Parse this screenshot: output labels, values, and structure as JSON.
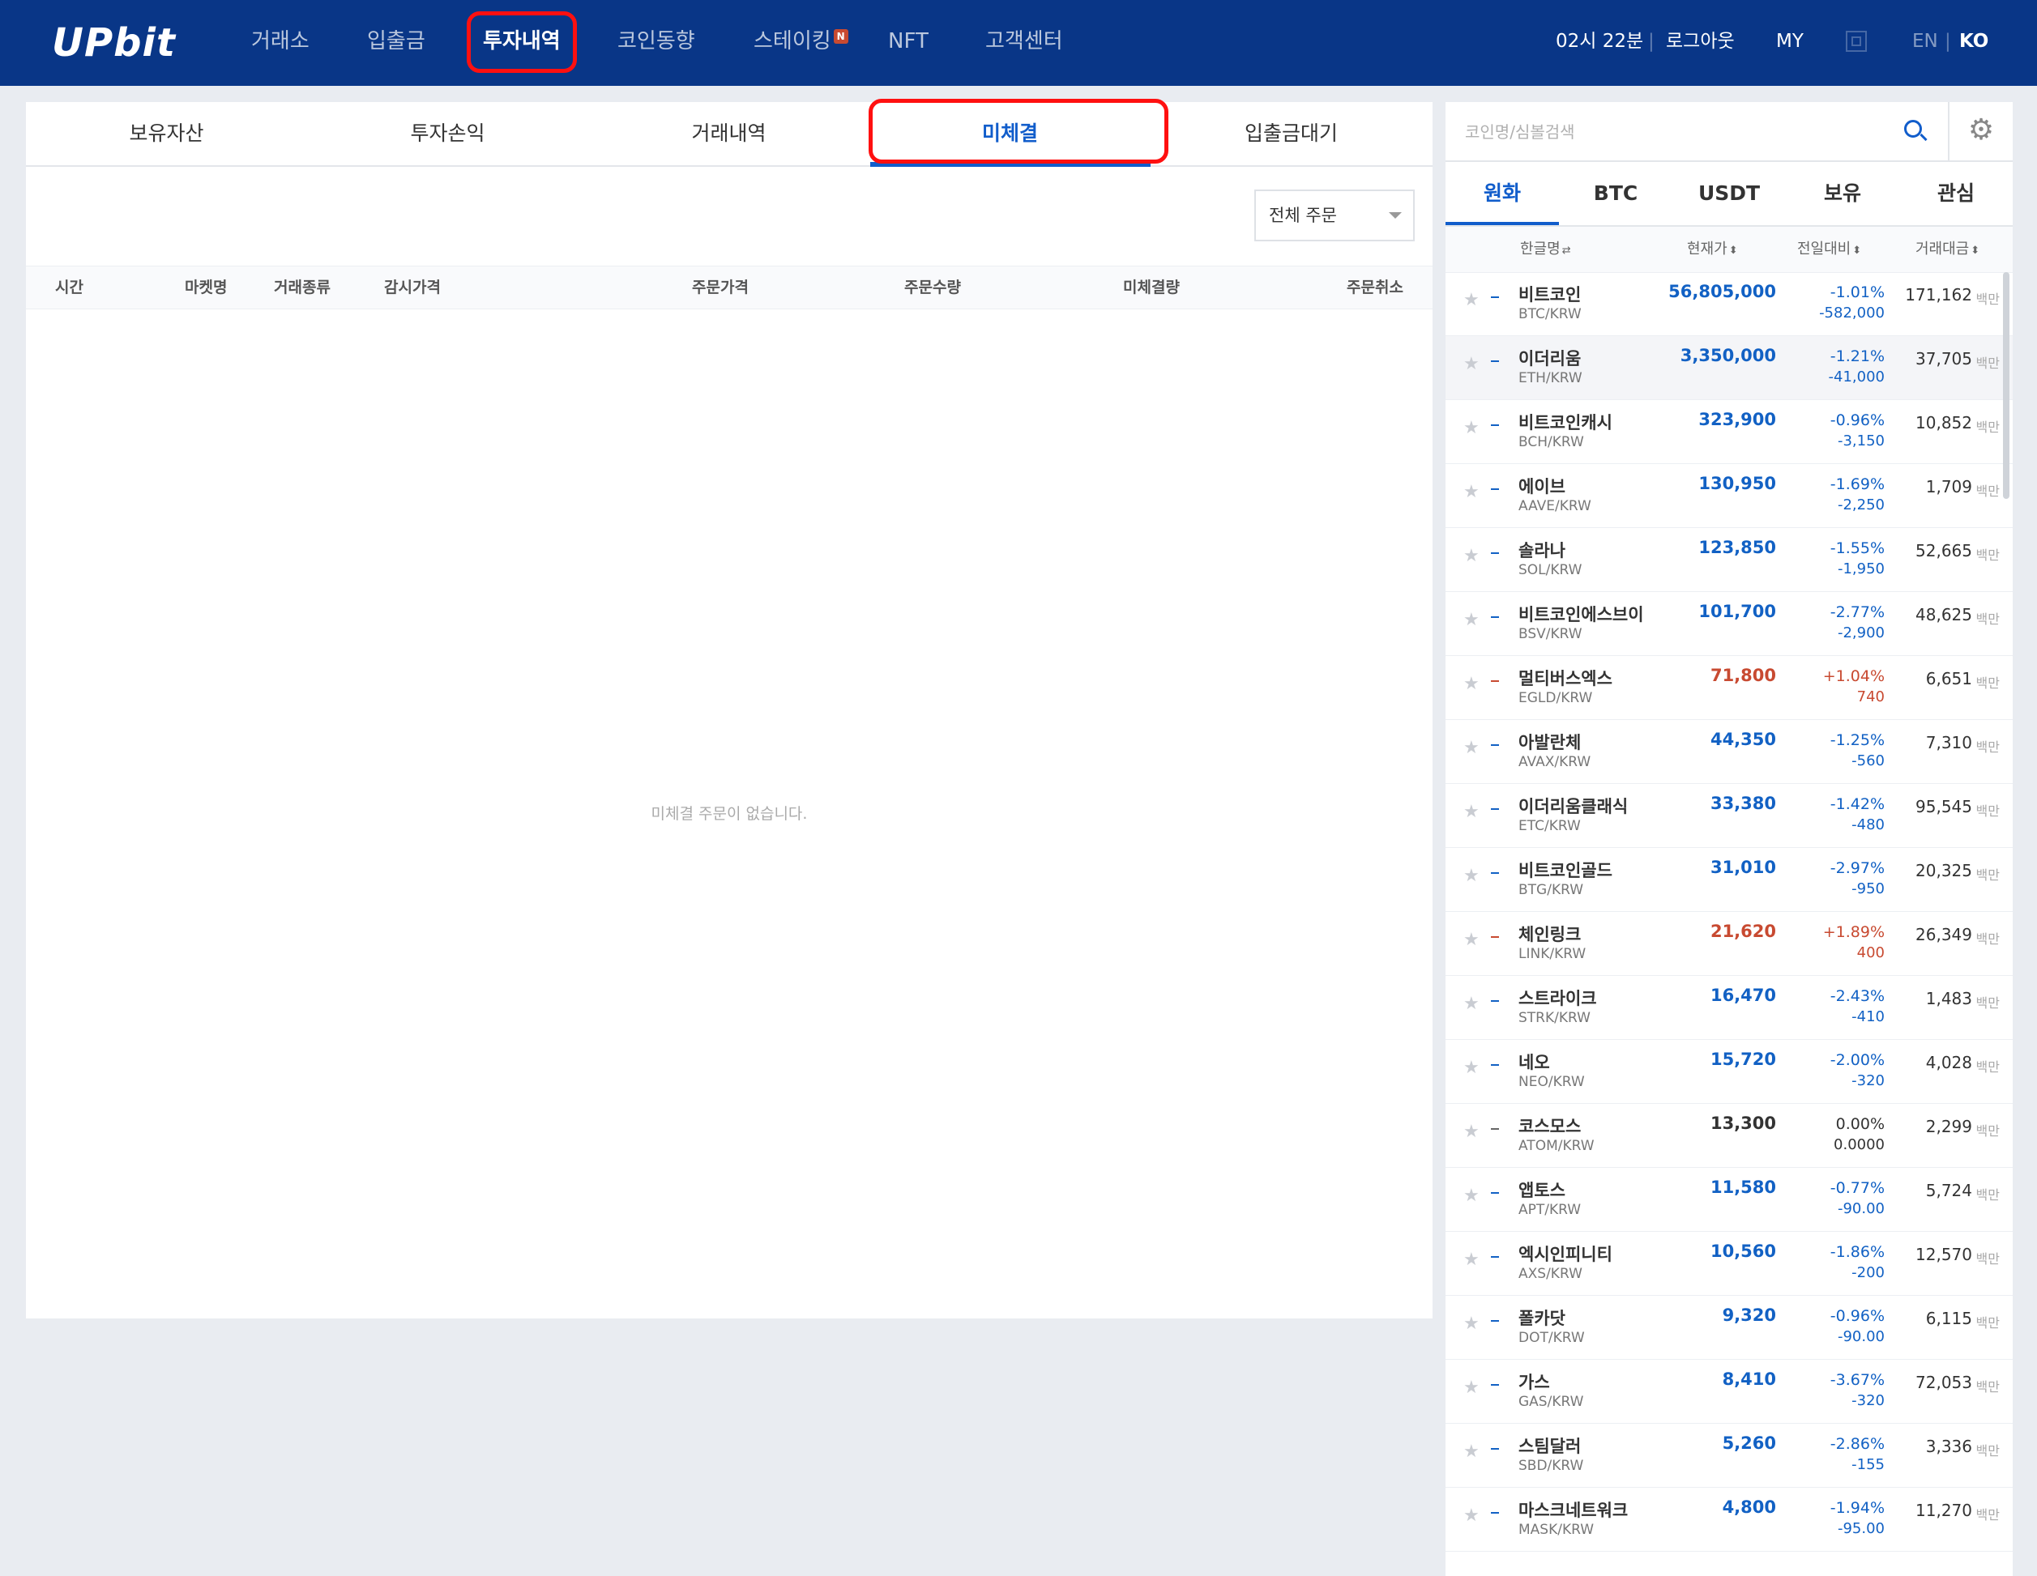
{
  "header": {
    "logo": "UPbit",
    "nav": [
      {
        "label": "거래소"
      },
      {
        "label": "입출금"
      },
      {
        "label": "투자내역"
      },
      {
        "label": "코인동향"
      },
      {
        "label": "스테이킹",
        "badge": "N"
      },
      {
        "label": "NFT"
      },
      {
        "label": "고객센터"
      }
    ],
    "time": "02시 22분",
    "separator": "|",
    "logout": "로그아웃",
    "my": "MY",
    "lang_en": "EN",
    "lang_ko": "KO"
  },
  "investment": {
    "tabs": [
      {
        "label": "보유자산"
      },
      {
        "label": "투자손익"
      },
      {
        "label": "거래내역"
      },
      {
        "label": "미체결"
      },
      {
        "label": "입출금대기"
      }
    ],
    "active_tab": "미체결",
    "filter_value": "전체 주문",
    "columns": {
      "time": "시간",
      "market": "마켓명",
      "trade_type": "거래종류",
      "watch_price": "감시가격",
      "order_price": "주문가격",
      "order_qty": "주문수량",
      "unfilled_qty": "미체결량",
      "cancel": "주문취소"
    },
    "empty_message": "미체결 주문이 없습니다."
  },
  "market": {
    "search_placeholder": "코인명/심볼검색",
    "tabs": [
      {
        "label": "원화"
      },
      {
        "label": "BTC"
      },
      {
        "label": "USDT"
      },
      {
        "label": "보유"
      },
      {
        "label": "관심"
      }
    ],
    "active_tab": "원화",
    "columns": {
      "name": "한글명",
      "price": "현재가",
      "change": "전일대비",
      "volume": "거래대금"
    },
    "volume_unit": "백만",
    "colors": {
      "down": "#1261c4",
      "up": "#c84a31",
      "even": "#333333"
    },
    "coins": [
      {
        "name": "비트코인",
        "pair": "BTC/KRW",
        "price": "56,805,000",
        "rate": "-1.01%",
        "diff": "-582,000",
        "volume": "171,162",
        "dir": "down"
      },
      {
        "name": "이더리움",
        "pair": "ETH/KRW",
        "price": "3,350,000",
        "rate": "-1.21%",
        "diff": "-41,000",
        "volume": "37,705",
        "dir": "down"
      },
      {
        "name": "비트코인캐시",
        "pair": "BCH/KRW",
        "price": "323,900",
        "rate": "-0.96%",
        "diff": "-3,150",
        "volume": "10,852",
        "dir": "down"
      },
      {
        "name": "에이브",
        "pair": "AAVE/KRW",
        "price": "130,950",
        "rate": "-1.69%",
        "diff": "-2,250",
        "volume": "1,709",
        "dir": "down"
      },
      {
        "name": "솔라나",
        "pair": "SOL/KRW",
        "price": "123,850",
        "rate": "-1.55%",
        "diff": "-1,950",
        "volume": "52,665",
        "dir": "down"
      },
      {
        "name": "비트코인에스브이",
        "pair": "BSV/KRW",
        "price": "101,700",
        "rate": "-2.77%",
        "diff": "-2,900",
        "volume": "48,625",
        "dir": "down"
      },
      {
        "name": "멀티버스엑스",
        "pair": "EGLD/KRW",
        "price": "71,800",
        "rate": "+1.04%",
        "diff": "740",
        "volume": "6,651",
        "dir": "up"
      },
      {
        "name": "아발란체",
        "pair": "AVAX/KRW",
        "price": "44,350",
        "rate": "-1.25%",
        "diff": "-560",
        "volume": "7,310",
        "dir": "down"
      },
      {
        "name": "이더리움클래식",
        "pair": "ETC/KRW",
        "price": "33,380",
        "rate": "-1.42%",
        "diff": "-480",
        "volume": "95,545",
        "dir": "down"
      },
      {
        "name": "비트코인골드",
        "pair": "BTG/KRW",
        "price": "31,010",
        "rate": "-2.97%",
        "diff": "-950",
        "volume": "20,325",
        "dir": "down"
      },
      {
        "name": "체인링크",
        "pair": "LINK/KRW",
        "price": "21,620",
        "rate": "+1.89%",
        "diff": "400",
        "volume": "26,349",
        "dir": "up"
      },
      {
        "name": "스트라이크",
        "pair": "STRK/KRW",
        "price": "16,470",
        "rate": "-2.43%",
        "diff": "-410",
        "volume": "1,483",
        "dir": "down"
      },
      {
        "name": "네오",
        "pair": "NEO/KRW",
        "price": "15,720",
        "rate": "-2.00%",
        "diff": "-320",
        "volume": "4,028",
        "dir": "down"
      },
      {
        "name": "코스모스",
        "pair": "ATOM/KRW",
        "price": "13,300",
        "rate": "0.00%",
        "diff": "0.0000",
        "volume": "2,299",
        "dir": "even"
      },
      {
        "name": "앱토스",
        "pair": "APT/KRW",
        "price": "11,580",
        "rate": "-0.77%",
        "diff": "-90.00",
        "volume": "5,724",
        "dir": "down"
      },
      {
        "name": "엑시인피니티",
        "pair": "AXS/KRW",
        "price": "10,560",
        "rate": "-1.86%",
        "diff": "-200",
        "volume": "12,570",
        "dir": "down"
      },
      {
        "name": "폴카닷",
        "pair": "DOT/KRW",
        "price": "9,320",
        "rate": "-0.96%",
        "diff": "-90.00",
        "volume": "6,115",
        "dir": "down"
      },
      {
        "name": "가스",
        "pair": "GAS/KRW",
        "price": "8,410",
        "rate": "-3.67%",
        "diff": "-320",
        "volume": "72,053",
        "dir": "down"
      },
      {
        "name": "스팀달러",
        "pair": "SBD/KRW",
        "price": "5,260",
        "rate": "-2.86%",
        "diff": "-155",
        "volume": "3,336",
        "dir": "down"
      },
      {
        "name": "마스크네트워크",
        "pair": "MASK/KRW",
        "price": "4,800",
        "rate": "-1.94%",
        "diff": "-95.00",
        "volume": "11,270",
        "dir": "down"
      }
    ]
  }
}
